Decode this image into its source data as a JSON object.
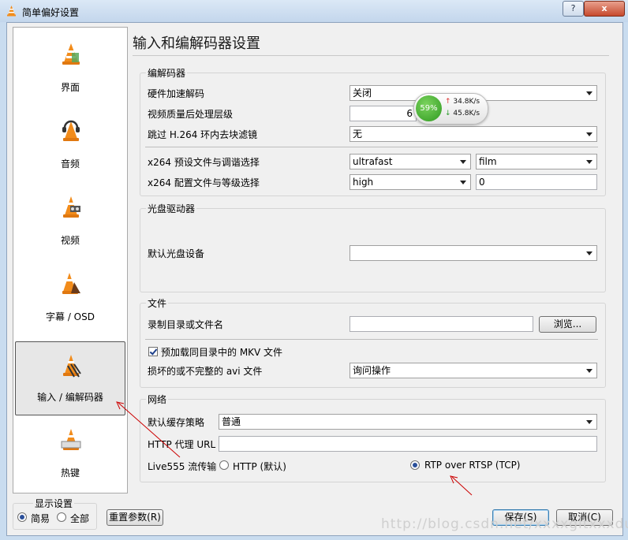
{
  "window": {
    "title": "简单偏好设置",
    "help_label": "?",
    "close_label": "x"
  },
  "sidebar": {
    "items": [
      {
        "label": "界面",
        "icon": "vlc-cone-interface-icon"
      },
      {
        "label": "音频",
        "icon": "vlc-cone-audio-icon"
      },
      {
        "label": "视频",
        "icon": "vlc-cone-video-icon"
      },
      {
        "label": "字幕 / OSD",
        "icon": "vlc-cone-subtitles-icon"
      },
      {
        "label": "输入 / 编解码器",
        "icon": "vlc-cone-input-icon",
        "selected": true
      },
      {
        "label": "热键",
        "icon": "vlc-cone-hotkeys-icon"
      }
    ]
  },
  "page": {
    "title": "输入和编解码器设置"
  },
  "codecs": {
    "title": "编解码器",
    "hw_label": "硬件加速解码",
    "hw_value": "关闭",
    "pp_label": "视频质量后处理层级",
    "pp_value": "6",
    "skip_label": "跳过 H.264 环内去块滤镜",
    "skip_value": "无",
    "x264_preset_label": "x264 预设文件与调谐选择",
    "x264_preset_value": "ultrafast",
    "x264_tune_value": "film",
    "x264_profile_label": "x264 配置文件与等级选择",
    "x264_profile_value": "high",
    "x264_level_value": "0"
  },
  "optical": {
    "title": "光盘驱动器",
    "device_label": "默认光盘设备",
    "device_value": ""
  },
  "files": {
    "title": "文件",
    "record_label": "录制目录或文件名",
    "record_value": "",
    "browse_label": "浏览...",
    "mkv_label": "预加载同目录中的 MKV 文件",
    "mkv_checked": true,
    "avi_label": "损坏的或不完整的 avi 文件",
    "avi_value": "询问操作"
  },
  "network": {
    "title": "网络",
    "cache_label": "默认缓存策略",
    "cache_value": "普通",
    "proxy_label": "HTTP 代理 URL",
    "proxy_value": "",
    "live555_label": "Live555 流传输",
    "http_option": "HTTP (默认)",
    "rtsp_option": "RTP over RTSP (TCP)",
    "selected": "rtsp"
  },
  "footer": {
    "show_settings_label": "显示设置",
    "simple_label": "简易",
    "all_label": "全部",
    "reset_label": "重置参数(R)",
    "save_label": "保存(S)",
    "cancel_label": "取消(C)"
  },
  "net_widget": {
    "percent": "59%",
    "up_speed": "34.8K/s",
    "down_speed": "45.8K/s"
  },
  "watermark": "http://blog.csdn.net/xxxxgitxxxdu",
  "colors": {
    "accent": "#3c7fb1",
    "annotation_arrow": "#cc0000",
    "net_green": "#2f9a20"
  }
}
